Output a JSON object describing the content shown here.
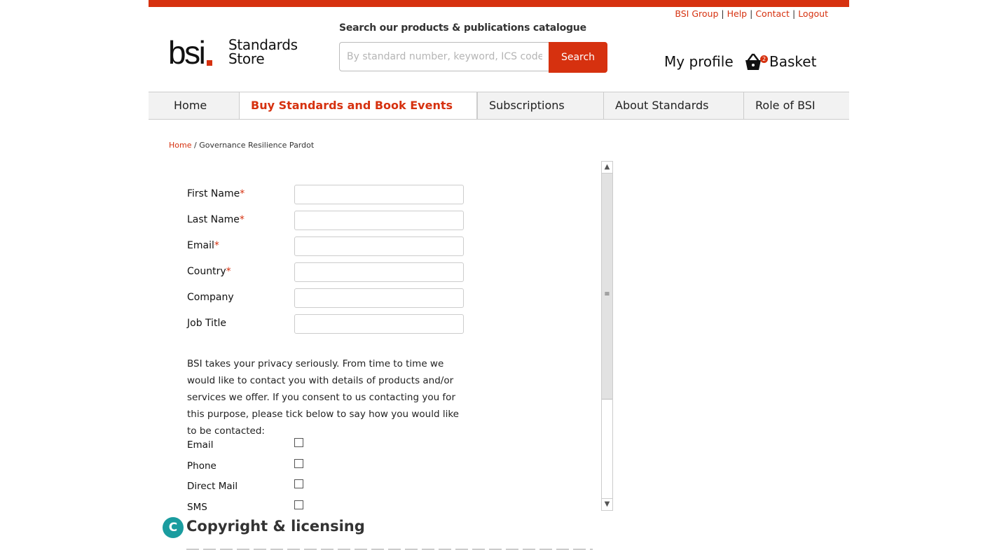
{
  "header": {
    "util_links": [
      "BSI Group",
      "Help",
      "Contact",
      "Logout"
    ],
    "logo_mark": "bsi",
    "logo_store_line1": "Standards",
    "logo_store_line2": "Store",
    "search_label": "Search our products & publications catalogue",
    "search_placeholder": "By standard number, keyword, ICS code, ISBN",
    "search_button": "Search",
    "my_profile": "My profile",
    "basket_label": "Basket",
    "basket_count": "2"
  },
  "nav": {
    "items": [
      "Home",
      "Buy Standards and Book Events",
      "Subscriptions",
      "About Standards",
      "Role of BSI"
    ],
    "active": "Buy Standards and Book Events"
  },
  "breadcrumb": {
    "home": "Home",
    "separator": "/",
    "current": "Governance Resilience Pardot"
  },
  "form": {
    "fields": [
      {
        "label": "First Name",
        "required": "*"
      },
      {
        "label": "Last Name",
        "required": "*"
      },
      {
        "label": "Email",
        "required": "*"
      },
      {
        "label": "Country",
        "required": "*"
      },
      {
        "label": "Company",
        "required": ""
      },
      {
        "label": "Job Title",
        "required": ""
      }
    ],
    "privacy_text": "BSI takes your privacy seriously. From time to time we would like to contact you with details of products and/or services we offer. If you consent to us contacting you for this purpose, please tick below to say how you would like to be contacted:",
    "checkboxes": [
      "Email",
      "Phone",
      "Direct Mail",
      "SMS"
    ]
  },
  "scrollbar": {
    "up_glyph": "▲",
    "down_glyph": "▼",
    "grip_glyph": "≡"
  },
  "copyright": {
    "badge": "C",
    "title": "Copyright & licensing"
  },
  "colors": {
    "brand": "#d6310f",
    "badge": "#1a9c9f"
  }
}
